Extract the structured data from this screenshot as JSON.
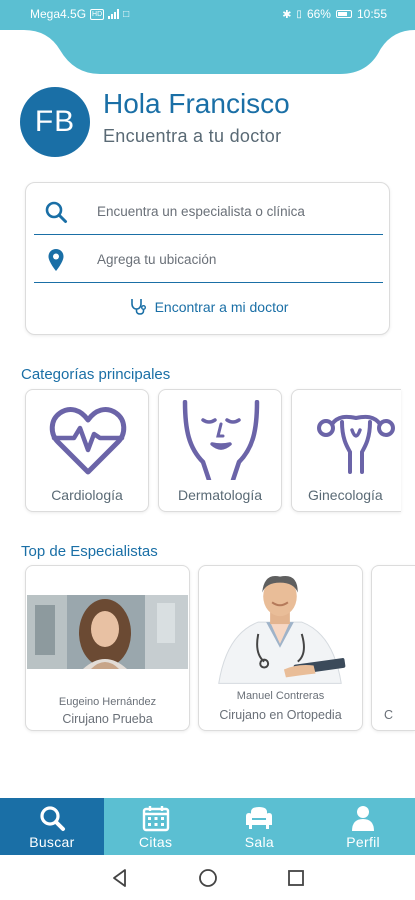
{
  "status_bar": {
    "carrier": "Mega4.5G",
    "hd_badge": "HD",
    "battery_percent": "66%",
    "time": "10:55"
  },
  "header": {
    "avatar_initials": "FB",
    "greeting": "Hola Francisco",
    "subtitle": "Encuentra a tu doctor"
  },
  "search": {
    "specialist_placeholder": "Encuentra un especialista o clínica",
    "location_placeholder": "Agrega tu ubicación",
    "find_button": "Encontrar a mi doctor"
  },
  "categories": {
    "title": "Categorías principales",
    "items": [
      {
        "label": "Cardiología",
        "icon": "heart-pulse-icon"
      },
      {
        "label": "Dermatología",
        "icon": "face-icon"
      },
      {
        "label": "Ginecología",
        "icon": "uterus-icon"
      }
    ]
  },
  "specialists": {
    "title": "Top de Especialistas",
    "items": [
      {
        "name": "Eugeino Hernández",
        "specialty": "Cirujano Prueba"
      },
      {
        "name": "Manuel Contreras",
        "specialty": "Cirujano en Ortopedia"
      },
      {
        "name": "",
        "specialty": "C"
      }
    ]
  },
  "bottom_nav": {
    "items": [
      {
        "label": "Buscar",
        "icon": "search-icon",
        "active": true
      },
      {
        "label": "Citas",
        "icon": "calendar-icon",
        "active": false
      },
      {
        "label": "Sala",
        "icon": "armchair-icon",
        "active": false
      },
      {
        "label": "Perfil",
        "icon": "user-icon",
        "active": false
      }
    ]
  },
  "colors": {
    "primary": "#1a6fa6",
    "accent": "#5bbfd2",
    "icon_purple": "#6b64a8"
  }
}
